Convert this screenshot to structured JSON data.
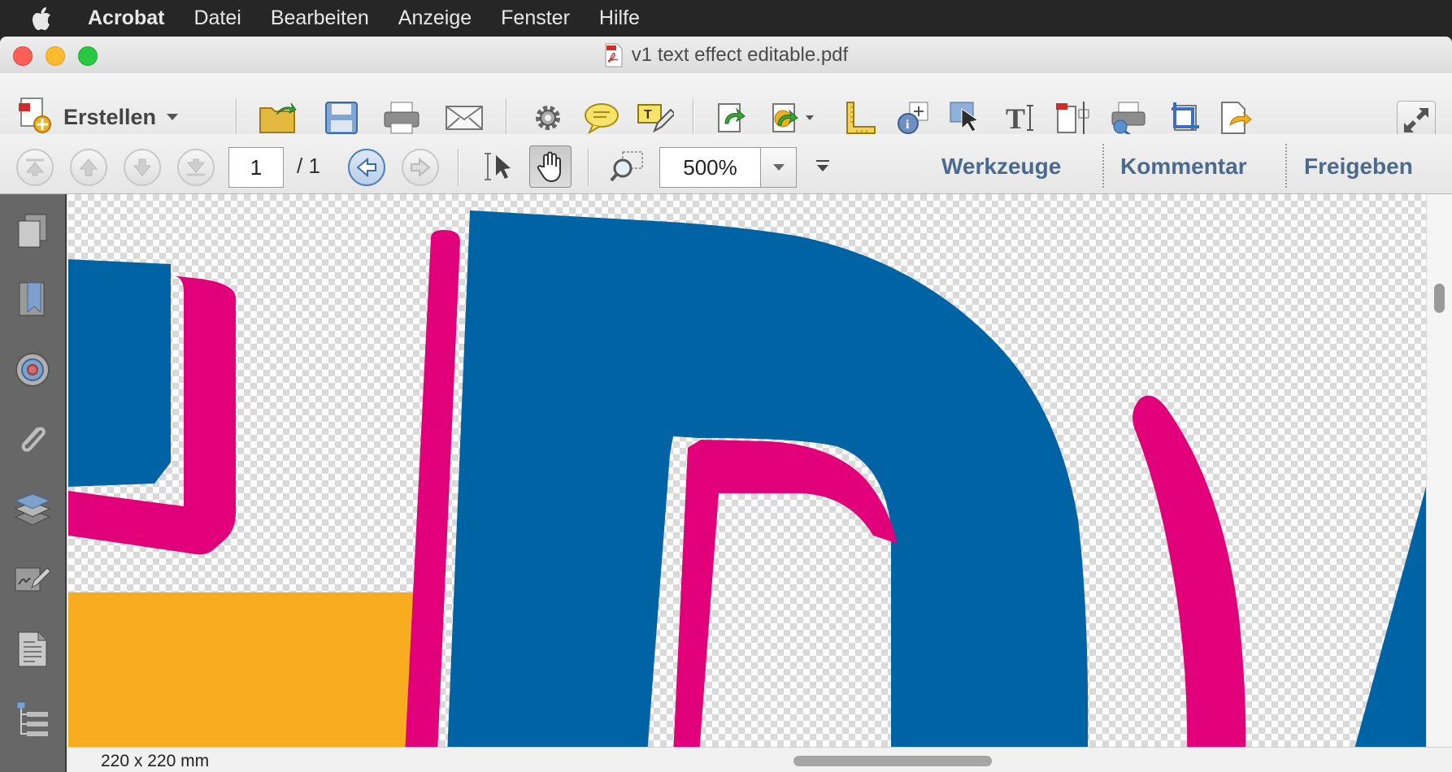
{
  "menubar": {
    "app": "Acrobat",
    "items": [
      "Datei",
      "Bearbeiten",
      "Anzeige",
      "Fenster",
      "Hilfe"
    ]
  },
  "window": {
    "title": "v1 text effect editable.pdf"
  },
  "toolbar": {
    "create_label": "Erstellen",
    "icons": [
      "open-folder-icon",
      "save-disk-icon",
      "print-icon",
      "email-icon",
      "gear-icon",
      "comment-bubble-icon",
      "highlight-pen-icon",
      "rotate-page-icon",
      "rotate-options-icon",
      "measure-ruler-icon",
      "object-info-icon",
      "select-object-icon",
      "text-tool-icon",
      "edit-object-icon",
      "print-production-icon",
      "crop-icon",
      "export-icon"
    ],
    "fullscreen": "fullscreen-icon"
  },
  "navbar": {
    "page_current": "1",
    "page_total": "/ 1",
    "zoom": "500%",
    "panels": [
      "Werkzeuge",
      "Kommentar",
      "Freigeben"
    ]
  },
  "leftpane": {
    "icons": [
      "page-thumbnails-icon",
      "bookmarks-icon",
      "destinations-icon",
      "attachments-icon",
      "layers-icon",
      "signatures-icon",
      "document-content-icon",
      "tags-tree-icon"
    ]
  },
  "status": {
    "page_size": "220 x 220 mm"
  },
  "colors": {
    "blue": "#0064a4",
    "magenta": "#e2007a",
    "orange": "#f7ad1f",
    "link": "#4a6a8f"
  }
}
